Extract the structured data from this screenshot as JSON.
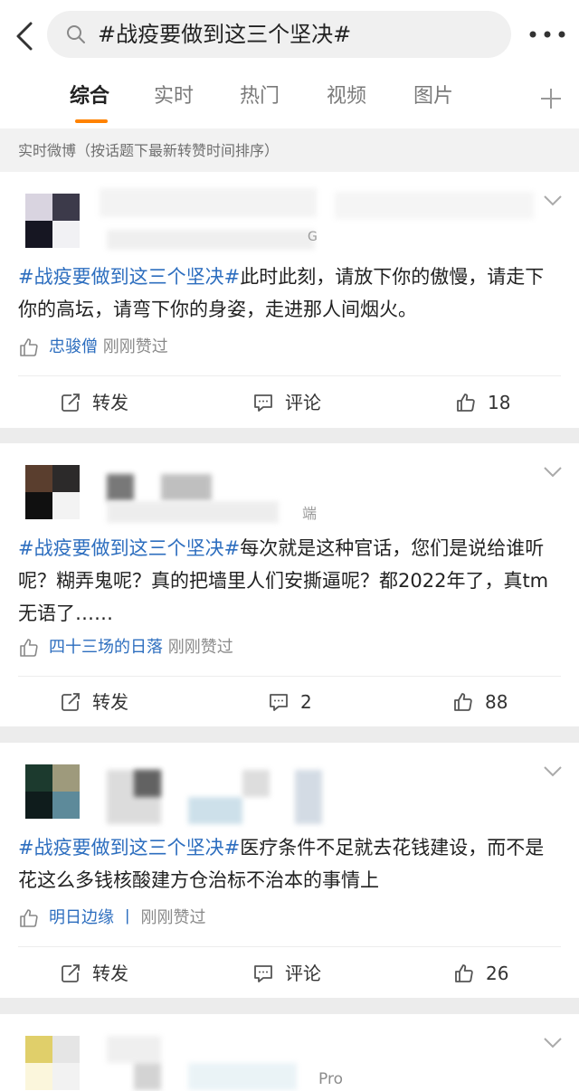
{
  "search": {
    "query": "#战疫要做到这三个坚决#"
  },
  "tabs": [
    {
      "label": "综合",
      "active": true
    },
    {
      "label": "实时",
      "active": false
    },
    {
      "label": "热门",
      "active": false
    },
    {
      "label": "视频",
      "active": false
    },
    {
      "label": "图片",
      "active": false
    }
  ],
  "section_label": "实时微博（按话题下最新转赞时间排序）",
  "posts": [
    {
      "meta_fragment": "G",
      "hashtag": "#战疫要做到这三个坚决#",
      "text": "此时此刻，请放下你的傲慢，请走下你的高坛，请弯下你的身姿，走进那人间烟火。",
      "liked_user": "忠骏僧",
      "liked_suffix": "刚刚赞过",
      "repost": "转发",
      "comment": "评论",
      "likes": "18"
    },
    {
      "meta_fragment": "端",
      "hashtag": "#战疫要做到这三个坚决#",
      "text": "每次就是这种官话，您们是说给谁听呢？糊弄鬼呢？真的把墙里人们安撕逼呢？都2022年了，真tm无语了……",
      "liked_user": "四十三场的日落",
      "liked_suffix": "刚刚赞过",
      "repost": "转发",
      "comment": "2",
      "likes": "88"
    },
    {
      "meta_fragment": "",
      "hashtag": "#战疫要做到这三个坚决#",
      "text": "医疗条件不足就去花钱建设，而不是花这么多钱核酸建方仓治标不治本的事情上",
      "liked_user": "明日边缘 丨",
      "liked_suffix": "刚刚赞过",
      "repost": "转发",
      "comment": "评论",
      "likes": "26"
    },
    {
      "meta_fragment": "Pro"
    }
  ],
  "colors": {
    "accent": "#ff8200",
    "link": "#2d6ebf"
  }
}
